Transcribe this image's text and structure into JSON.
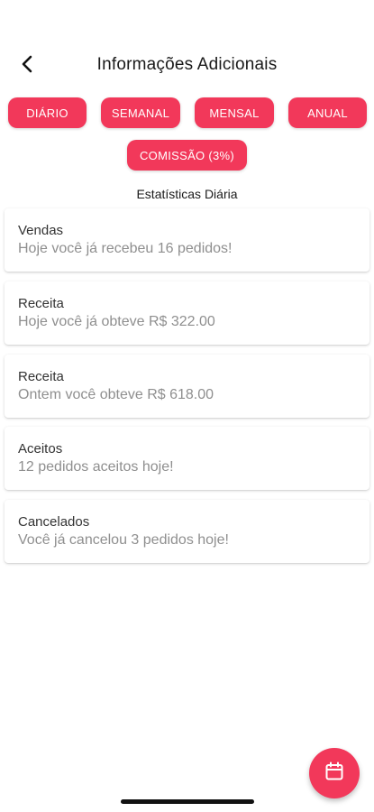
{
  "header": {
    "title": "Informações Adicionais",
    "back_icon": "chevron-left-icon"
  },
  "filters": {
    "daily": "DIÁRIO",
    "weekly": "SEMANAL",
    "monthly": "MENSAL",
    "yearly": "ANUAL",
    "commission": "COMISSÃO (3%)"
  },
  "section_title": "Estatísticas Diária",
  "cards": [
    {
      "title": "Vendas",
      "subtitle": "Hoje você já recebeu 16 pedidos!"
    },
    {
      "title": "Receita",
      "subtitle": "Hoje você já obteve R$ 322.00"
    },
    {
      "title": "Receita",
      "subtitle": "Ontem você obteve R$ 618.00"
    },
    {
      "title": "Aceitos",
      "subtitle": "12 pedidos aceitos hoje!"
    },
    {
      "title": "Cancelados",
      "subtitle": "Você já cancelou 3 pedidos hoje!"
    }
  ],
  "fab": {
    "icon": "calendar-icon"
  },
  "colors": {
    "accent": "#f2385a",
    "text_primary": "#1a1a1a",
    "text_secondary": "#8f8f8f"
  }
}
